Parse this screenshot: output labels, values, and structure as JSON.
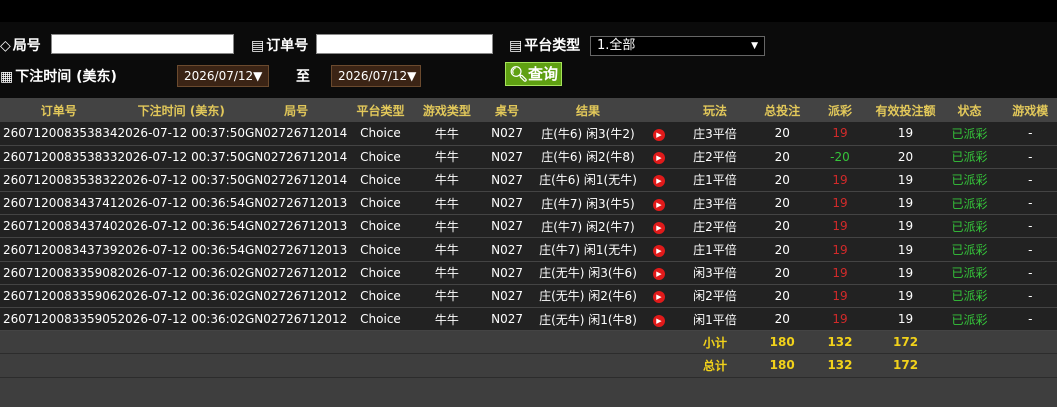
{
  "filters": {
    "round_label": "局号",
    "order_label": "订单号",
    "platform_label": "平台类型",
    "platform_value": "1.全部",
    "time_label": "下注时间 (美东)",
    "date_from": "2026/07/12",
    "to_label": "至",
    "date_to": "2026/07/12",
    "query_label": "查询"
  },
  "columns": [
    "订单号",
    "下注时间 (美东)",
    "局号",
    "平台类型",
    "游戏类型",
    "桌号",
    "结果",
    "",
    "玩法",
    "总投注",
    "派彩",
    "有效投注额",
    "状态",
    "游戏模"
  ],
  "rows": [
    {
      "order": "260712008353834",
      "time": "2026-07-12 00:37:50",
      "round": "GN02726712014",
      "platform": "Choice",
      "game": "牛牛",
      "table": "N027",
      "result": "庄(牛6) 闲3(牛2)",
      "play": "庄3平倍",
      "bet": "20",
      "payout": "19",
      "valid": "19",
      "status": "已派彩",
      "mode": "-"
    },
    {
      "order": "260712008353833",
      "time": "2026-07-12 00:37:50",
      "round": "GN02726712014",
      "platform": "Choice",
      "game": "牛牛",
      "table": "N027",
      "result": "庄(牛6) 闲2(牛8)",
      "play": "庄2平倍",
      "bet": "20",
      "payout": "-20",
      "valid": "20",
      "status": "已派彩",
      "mode": "-"
    },
    {
      "order": "260712008353832",
      "time": "2026-07-12 00:37:50",
      "round": "GN02726712014",
      "platform": "Choice",
      "game": "牛牛",
      "table": "N027",
      "result": "庄(牛6) 闲1(无牛)",
      "play": "庄1平倍",
      "bet": "20",
      "payout": "19",
      "valid": "19",
      "status": "已派彩",
      "mode": "-"
    },
    {
      "order": "260712008343741",
      "time": "2026-07-12 00:36:54",
      "round": "GN02726712013",
      "platform": "Choice",
      "game": "牛牛",
      "table": "N027",
      "result": "庄(牛7) 闲3(牛5)",
      "play": "庄3平倍",
      "bet": "20",
      "payout": "19",
      "valid": "19",
      "status": "已派彩",
      "mode": "-"
    },
    {
      "order": "260712008343740",
      "time": "2026-07-12 00:36:54",
      "round": "GN02726712013",
      "platform": "Choice",
      "game": "牛牛",
      "table": "N027",
      "result": "庄(牛7) 闲2(牛7)",
      "play": "庄2平倍",
      "bet": "20",
      "payout": "19",
      "valid": "19",
      "status": "已派彩",
      "mode": "-"
    },
    {
      "order": "260712008343739",
      "time": "2026-07-12 00:36:54",
      "round": "GN02726712013",
      "platform": "Choice",
      "game": "牛牛",
      "table": "N027",
      "result": "庄(牛7) 闲1(无牛)",
      "play": "庄1平倍",
      "bet": "20",
      "payout": "19",
      "valid": "19",
      "status": "已派彩",
      "mode": "-"
    },
    {
      "order": "260712008335908",
      "time": "2026-07-12 00:36:02",
      "round": "GN02726712012",
      "platform": "Choice",
      "game": "牛牛",
      "table": "N027",
      "result": "庄(无牛) 闲3(牛6)",
      "play": "闲3平倍",
      "bet": "20",
      "payout": "19",
      "valid": "19",
      "status": "已派彩",
      "mode": "-"
    },
    {
      "order": "260712008335906",
      "time": "2026-07-12 00:36:02",
      "round": "GN02726712012",
      "platform": "Choice",
      "game": "牛牛",
      "table": "N027",
      "result": "庄(无牛) 闲2(牛6)",
      "play": "闲2平倍",
      "bet": "20",
      "payout": "19",
      "valid": "19",
      "status": "已派彩",
      "mode": "-"
    },
    {
      "order": "260712008335905",
      "time": "2026-07-12 00:36:02",
      "round": "GN02726712012",
      "platform": "Choice",
      "game": "牛牛",
      "table": "N027",
      "result": "庄(无牛) 闲1(牛8)",
      "play": "闲1平倍",
      "bet": "20",
      "payout": "19",
      "valid": "19",
      "status": "已派彩",
      "mode": "-"
    }
  ],
  "subtotal": {
    "label": "小计",
    "bet": "180",
    "payout": "132",
    "valid": "172"
  },
  "total": {
    "label": "总计",
    "bet": "180",
    "payout": "132",
    "valid": "172"
  },
  "colors": {
    "positive": "#d12a2a",
    "negative": "#35c43a",
    "status": "#35c43a",
    "header_text": "#e2c85a",
    "sum_text": "#f2d21a",
    "query_button": "#5fa012"
  }
}
